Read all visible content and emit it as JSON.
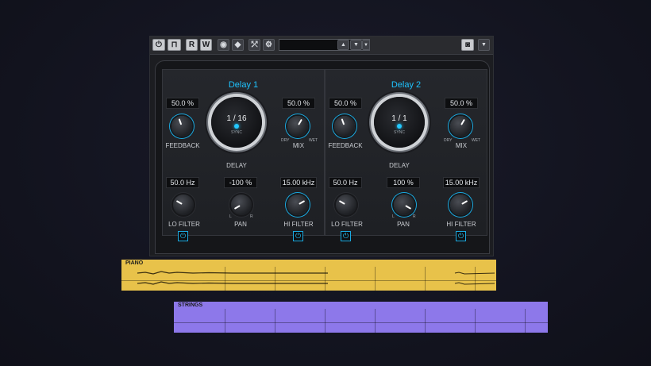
{
  "toolbar": {
    "buttons": [
      {
        "label": "",
        "icon": "power-icon"
      },
      {
        "label": "",
        "icon": "bypass-icon"
      },
      {
        "label": "R"
      },
      {
        "label": "W"
      },
      {
        "label": "",
        "icon": "compare-icon"
      },
      {
        "label": "",
        "icon": "prev-icon"
      },
      {
        "label": "",
        "icon": "routing-icon"
      },
      {
        "label": "",
        "icon": "gear-icon"
      }
    ],
    "preset_value": "",
    "camera_icon": "camera-icon",
    "menu_icon": "chevron-down-icon"
  },
  "delay1": {
    "title": "Delay 1",
    "feedback_value": "50.0 %",
    "feedback_label": "FEEDBACK",
    "mix_value": "50.0 %",
    "mix_label": "MIX",
    "dry": "DRY",
    "wet": "WET",
    "delay_value": "1 / 16",
    "sync": "SYNC",
    "delay_label": "DELAY",
    "lofilter_value": "50.0 Hz",
    "lofilter_label": "LO FILTER",
    "pan_value": "-100 %",
    "pan_label": "PAN",
    "pan_l": "L",
    "pan_r": "R",
    "hifilter_value": "15.00 kHz",
    "hifilter_label": "HI FILTER"
  },
  "delay2": {
    "title": "Delay 2",
    "feedback_value": "50.0 %",
    "feedback_label": "FEEDBACK",
    "mix_value": "50.0 %",
    "mix_label": "MIX",
    "dry": "DRY",
    "wet": "WET",
    "delay_value": "1 / 1",
    "sync": "SYNC",
    "delay_label": "DELAY",
    "lofilter_value": "50.0 Hz",
    "lofilter_label": "LO FILTER",
    "pan_value": "100 %",
    "pan_label": "PAN",
    "pan_l": "L",
    "pan_r": "R",
    "hifilter_value": "15.00 kHz",
    "hifilter_label": "HI FILTER"
  },
  "tracks": [
    {
      "name": "PIANO",
      "color": "#e8c24a"
    },
    {
      "name": "STRINGS",
      "color": "#8d78ea"
    }
  ],
  "colors": {
    "accent": "#1ec3ff"
  }
}
